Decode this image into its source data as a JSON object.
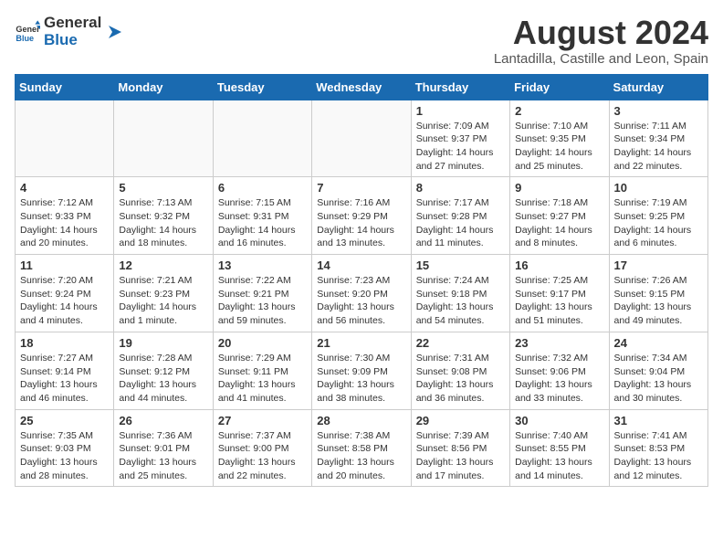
{
  "header": {
    "logo_general": "General",
    "logo_blue": "Blue",
    "title": "August 2024",
    "subtitle": "Lantadilla, Castille and Leon, Spain"
  },
  "weekdays": [
    "Sunday",
    "Monday",
    "Tuesday",
    "Wednesday",
    "Thursday",
    "Friday",
    "Saturday"
  ],
  "weeks": [
    [
      {
        "day": "",
        "info": ""
      },
      {
        "day": "",
        "info": ""
      },
      {
        "day": "",
        "info": ""
      },
      {
        "day": "",
        "info": ""
      },
      {
        "day": "1",
        "info": "Sunrise: 7:09 AM\nSunset: 9:37 PM\nDaylight: 14 hours\nand 27 minutes."
      },
      {
        "day": "2",
        "info": "Sunrise: 7:10 AM\nSunset: 9:35 PM\nDaylight: 14 hours\nand 25 minutes."
      },
      {
        "day": "3",
        "info": "Sunrise: 7:11 AM\nSunset: 9:34 PM\nDaylight: 14 hours\nand 22 minutes."
      }
    ],
    [
      {
        "day": "4",
        "info": "Sunrise: 7:12 AM\nSunset: 9:33 PM\nDaylight: 14 hours\nand 20 minutes."
      },
      {
        "day": "5",
        "info": "Sunrise: 7:13 AM\nSunset: 9:32 PM\nDaylight: 14 hours\nand 18 minutes."
      },
      {
        "day": "6",
        "info": "Sunrise: 7:15 AM\nSunset: 9:31 PM\nDaylight: 14 hours\nand 16 minutes."
      },
      {
        "day": "7",
        "info": "Sunrise: 7:16 AM\nSunset: 9:29 PM\nDaylight: 14 hours\nand 13 minutes."
      },
      {
        "day": "8",
        "info": "Sunrise: 7:17 AM\nSunset: 9:28 PM\nDaylight: 14 hours\nand 11 minutes."
      },
      {
        "day": "9",
        "info": "Sunrise: 7:18 AM\nSunset: 9:27 PM\nDaylight: 14 hours\nand 8 minutes."
      },
      {
        "day": "10",
        "info": "Sunrise: 7:19 AM\nSunset: 9:25 PM\nDaylight: 14 hours\nand 6 minutes."
      }
    ],
    [
      {
        "day": "11",
        "info": "Sunrise: 7:20 AM\nSunset: 9:24 PM\nDaylight: 14 hours\nand 4 minutes."
      },
      {
        "day": "12",
        "info": "Sunrise: 7:21 AM\nSunset: 9:23 PM\nDaylight: 14 hours\nand 1 minute."
      },
      {
        "day": "13",
        "info": "Sunrise: 7:22 AM\nSunset: 9:21 PM\nDaylight: 13 hours\nand 59 minutes."
      },
      {
        "day": "14",
        "info": "Sunrise: 7:23 AM\nSunset: 9:20 PM\nDaylight: 13 hours\nand 56 minutes."
      },
      {
        "day": "15",
        "info": "Sunrise: 7:24 AM\nSunset: 9:18 PM\nDaylight: 13 hours\nand 54 minutes."
      },
      {
        "day": "16",
        "info": "Sunrise: 7:25 AM\nSunset: 9:17 PM\nDaylight: 13 hours\nand 51 minutes."
      },
      {
        "day": "17",
        "info": "Sunrise: 7:26 AM\nSunset: 9:15 PM\nDaylight: 13 hours\nand 49 minutes."
      }
    ],
    [
      {
        "day": "18",
        "info": "Sunrise: 7:27 AM\nSunset: 9:14 PM\nDaylight: 13 hours\nand 46 minutes."
      },
      {
        "day": "19",
        "info": "Sunrise: 7:28 AM\nSunset: 9:12 PM\nDaylight: 13 hours\nand 44 minutes."
      },
      {
        "day": "20",
        "info": "Sunrise: 7:29 AM\nSunset: 9:11 PM\nDaylight: 13 hours\nand 41 minutes."
      },
      {
        "day": "21",
        "info": "Sunrise: 7:30 AM\nSunset: 9:09 PM\nDaylight: 13 hours\nand 38 minutes."
      },
      {
        "day": "22",
        "info": "Sunrise: 7:31 AM\nSunset: 9:08 PM\nDaylight: 13 hours\nand 36 minutes."
      },
      {
        "day": "23",
        "info": "Sunrise: 7:32 AM\nSunset: 9:06 PM\nDaylight: 13 hours\nand 33 minutes."
      },
      {
        "day": "24",
        "info": "Sunrise: 7:34 AM\nSunset: 9:04 PM\nDaylight: 13 hours\nand 30 minutes."
      }
    ],
    [
      {
        "day": "25",
        "info": "Sunrise: 7:35 AM\nSunset: 9:03 PM\nDaylight: 13 hours\nand 28 minutes."
      },
      {
        "day": "26",
        "info": "Sunrise: 7:36 AM\nSunset: 9:01 PM\nDaylight: 13 hours\nand 25 minutes."
      },
      {
        "day": "27",
        "info": "Sunrise: 7:37 AM\nSunset: 9:00 PM\nDaylight: 13 hours\nand 22 minutes."
      },
      {
        "day": "28",
        "info": "Sunrise: 7:38 AM\nSunset: 8:58 PM\nDaylight: 13 hours\nand 20 minutes."
      },
      {
        "day": "29",
        "info": "Sunrise: 7:39 AM\nSunset: 8:56 PM\nDaylight: 13 hours\nand 17 minutes."
      },
      {
        "day": "30",
        "info": "Sunrise: 7:40 AM\nSunset: 8:55 PM\nDaylight: 13 hours\nand 14 minutes."
      },
      {
        "day": "31",
        "info": "Sunrise: 7:41 AM\nSunset: 8:53 PM\nDaylight: 13 hours\nand 12 minutes."
      }
    ]
  ]
}
